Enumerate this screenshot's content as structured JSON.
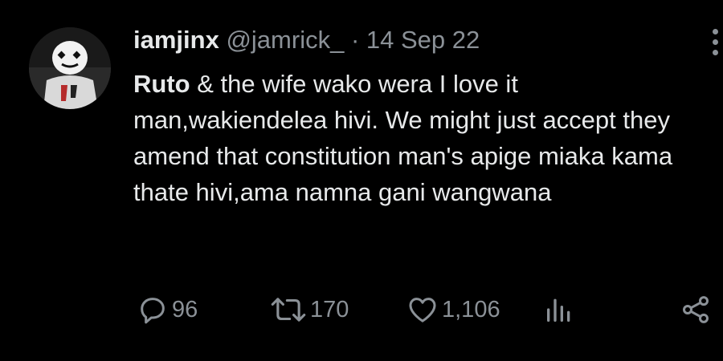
{
  "tweet": {
    "display_name": "iamjinx",
    "handle": "@jamrick_",
    "separator": "·",
    "date": "14 Sep 22",
    "mention": "Ruto",
    "text": " & the wife wako wera I love it man,wakiendelea hivi. We might just accept they amend that constitution man's apige miaka kama thate hivi,ama namna gani wangwana"
  },
  "actions": {
    "reply_count": "96",
    "retweet_count": "170",
    "like_count": "1,106"
  },
  "icons": {
    "reply": "reply-icon",
    "retweet": "retweet-icon",
    "like": "heart-icon",
    "views": "analytics-icon",
    "share": "share-icon",
    "more": "more-options-icon"
  },
  "colors": {
    "background": "#000000",
    "primary_text": "#e7e9ea",
    "secondary_text": "#8b9197"
  }
}
